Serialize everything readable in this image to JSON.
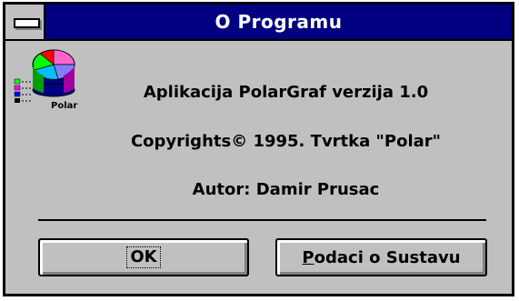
{
  "window": {
    "title": "O Programu"
  },
  "logo": {
    "caption": "Polar",
    "colors": [
      "#ff0000",
      "#ff00ff",
      "#0000ff",
      "#00ffff",
      "#00ff00",
      "#ffff00",
      "#c0c0c0"
    ]
  },
  "info": {
    "app_line": "Aplikacija PolarGraf verzija 1.0",
    "copyright_line": "Copyrights© 1995. Tvrtka \"Polar\"",
    "author_line": "Autor: Damir Prusac"
  },
  "buttons": {
    "ok": {
      "label": "OK"
    },
    "system_info": {
      "mnemonic": "P",
      "rest": "odaci o Sustavu"
    }
  },
  "icons": {
    "system_menu": "system-menu-icon",
    "logo": "polar-graph-logo-icon"
  }
}
